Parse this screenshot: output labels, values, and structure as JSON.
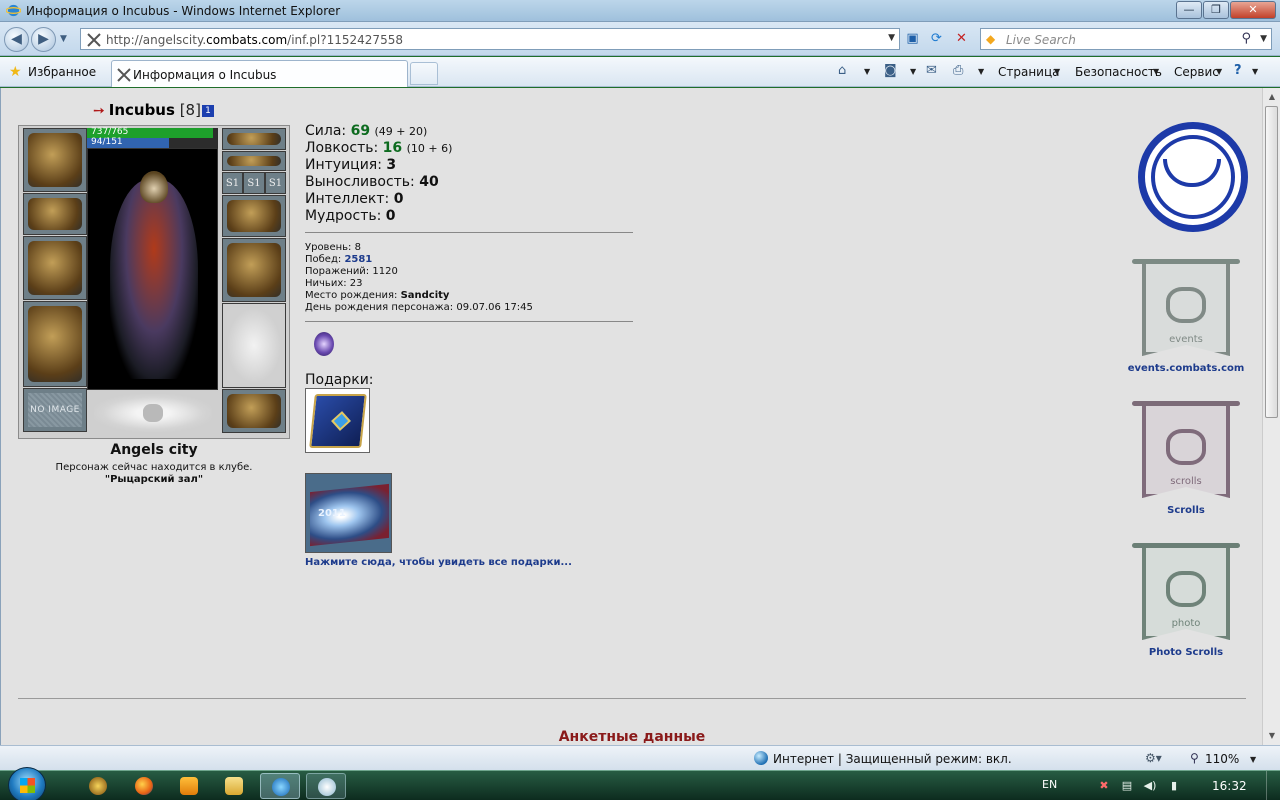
{
  "window": {
    "title": "Информация о Incubus - Windows Internet Explorer",
    "min_glyph": "—",
    "max_glyph": "❐",
    "close_glyph": "✕"
  },
  "addressbar": {
    "url_prefix": "http://angelscity.",
    "url_host": "combats.com",
    "url_suffix": "/inf.pl?1152427558",
    "search_placeholder": "Live Search"
  },
  "command_bar": {
    "favorites_label": "Избранное",
    "tab_title": "Информация о Incubus",
    "page_menu": "Страница",
    "safety_menu": "Безопасность",
    "tools_menu": "Сервис",
    "help_glyph": "?"
  },
  "character": {
    "name": "Incubus",
    "level_text": "[8]",
    "badge": "1",
    "hp_text": "737/765",
    "hp_fraction": 0.963,
    "mp_text": "94/151",
    "mp_fraction": 0.623,
    "no_image_label": "NO IMAGE",
    "s1_label": "S1",
    "city": "Angels city",
    "location_line": "Персонаж сейчас находится в клубе.",
    "location_room": "\"Рыцарский зал\""
  },
  "stats": {
    "strength": {
      "label": "Сила:",
      "value": "69",
      "extra": "(49 + 20)"
    },
    "agility": {
      "label": "Ловкость:",
      "value": "16",
      "extra": "(10 + 6)"
    },
    "intuition": {
      "label": "Интуиция:",
      "value": "3"
    },
    "endurance": {
      "label": "Выносливость:",
      "value": "40"
    },
    "intellect": {
      "label": "Интеллект:",
      "value": "0"
    },
    "wisdom": {
      "label": "Мудрость:",
      "value": "0"
    }
  },
  "info": {
    "level": {
      "label": "Уровень:",
      "value": "8"
    },
    "wins": {
      "label": "Побед:",
      "value": "2581"
    },
    "losses": {
      "label": "Поражений:",
      "value": "1120"
    },
    "draws": {
      "label": "Ничьих:",
      "value": "23"
    },
    "birthplace": {
      "label": "Место рождения:",
      "value": "Sandcity"
    },
    "birthday": {
      "label": "День рождения персонажа:",
      "value": "09.07.06 17:45"
    }
  },
  "gifts": {
    "label": "Подарки:",
    "card_year": "2011",
    "all_gifts_link": "Нажмите сюда, чтобы увидеть все подарки..."
  },
  "right_links": {
    "events_word": "events",
    "events_caption": "events.combats.com",
    "scrolls_word": "scrolls",
    "scrolls_caption": "Scrolls",
    "photo_word": "photo",
    "photo_caption": "Photo Scrolls"
  },
  "section": {
    "anketa_title": "Анкетные данные"
  },
  "statusbar": {
    "zone_text": "Интернет | Защищенный режим: вкл.",
    "zoom": "110%"
  },
  "taskbar": {
    "lang": "EN",
    "clock": "16:32"
  },
  "colors": {
    "page_bg": "#e2e2e2",
    "stat_green": "#0d6b1f",
    "link_blue": "#1d3b8c",
    "section_red": "#8a1a1a",
    "clan_blue": "#1d3aa8"
  },
  "icons": {
    "back": "back-arrow-icon",
    "forward": "forward-arrow-icon",
    "refresh": "refresh-icon",
    "stop": "stop-icon",
    "search": "search-icon",
    "favorites": "star-icon",
    "home": "home-icon",
    "feeds": "rss-feed-icon",
    "mail": "mail-icon",
    "print": "printer-icon",
    "help": "help-icon"
  }
}
